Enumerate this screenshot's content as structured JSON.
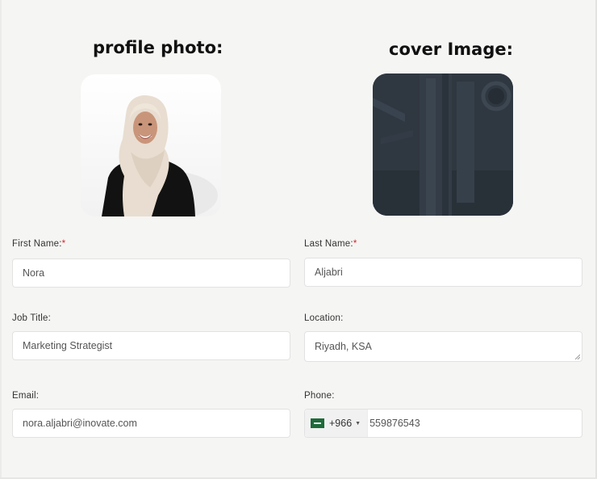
{
  "profile_photo": {
    "title": "profile photo:",
    "alt": "Profile photo of a woman wearing a beige hijab and black blazer"
  },
  "cover_image": {
    "title": "cover Image:",
    "alt": "Dark blue-gray cover image"
  },
  "form": {
    "first_name": {
      "label": "First Name:",
      "required_mark": "*",
      "value": "Nora"
    },
    "last_name": {
      "label": "Last Name:",
      "required_mark": "*",
      "value": "Aljabri"
    },
    "job_title": {
      "label": "Job Title:",
      "value": "Marketing Strategist"
    },
    "location": {
      "label": "Location:",
      "value": "Riyadh, KSA"
    },
    "email": {
      "label": "Email:",
      "value": "nora.aljabri@inovate.com"
    },
    "phone": {
      "label": "Phone:",
      "country_flag_icon": "saudi-arabia-flag-icon",
      "dial_code": "+966",
      "caret_icon": "caret-down-icon",
      "value": "559876543"
    }
  },
  "colors": {
    "background": "#f5f5f3",
    "required": "#d9232d",
    "cover": "#2f3740"
  }
}
